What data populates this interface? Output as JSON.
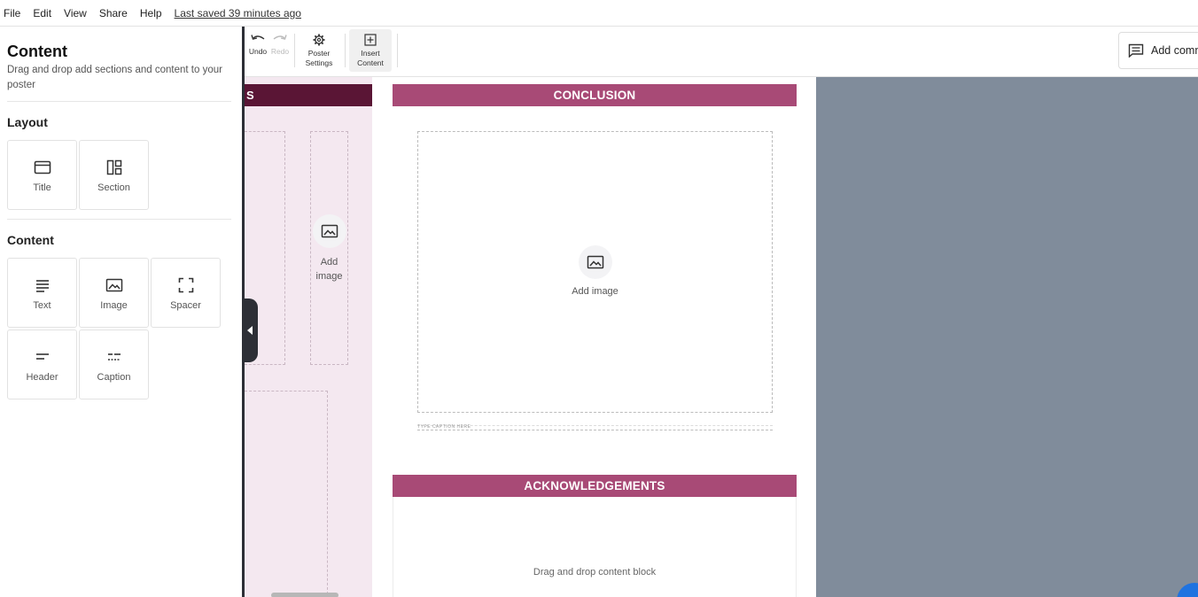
{
  "menu": {
    "items": [
      "File",
      "Edit",
      "View",
      "Share",
      "Help"
    ],
    "saved_status": "Last saved 39 minutes ago"
  },
  "left_panel": {
    "title": "Content",
    "description": "Drag and drop add sections and content to your poster",
    "layout": {
      "heading": "Layout",
      "items": [
        {
          "label": "Title",
          "icon": "title-icon"
        },
        {
          "label": "Section",
          "icon": "section-icon"
        }
      ]
    },
    "content": {
      "heading": "Content",
      "items": [
        {
          "label": "Text",
          "icon": "text-icon"
        },
        {
          "label": "Image",
          "icon": "image-icon"
        },
        {
          "label": "Spacer",
          "icon": "spacer-icon"
        },
        {
          "label": "Header",
          "icon": "header-icon"
        },
        {
          "label": "Caption",
          "icon": "caption-icon"
        }
      ]
    }
  },
  "toolbar": {
    "undo": "Undo",
    "redo": "Redo",
    "poster_settings": [
      "Poster",
      "Settings"
    ],
    "insert_content": [
      "Insert",
      "Content"
    ],
    "add_comment": "Add comm"
  },
  "poster": {
    "left_header_partial": "S",
    "left_add_image": [
      "Add",
      "image"
    ],
    "conclusion_header": "CONCLUSION",
    "conclusion_add_image": "Add image",
    "caption_placeholder": "TYPE CAPTION HERE",
    "acknowledgements_header": "ACKNOWLEDGEMENTS",
    "ack_drag_text": "Drag and drop content block"
  },
  "colors": {
    "section_header": "#a84a76",
    "dark_header": "#5a1535",
    "left_column_bg": "#f4e8f0",
    "canvas_bg": "#808c9b"
  }
}
